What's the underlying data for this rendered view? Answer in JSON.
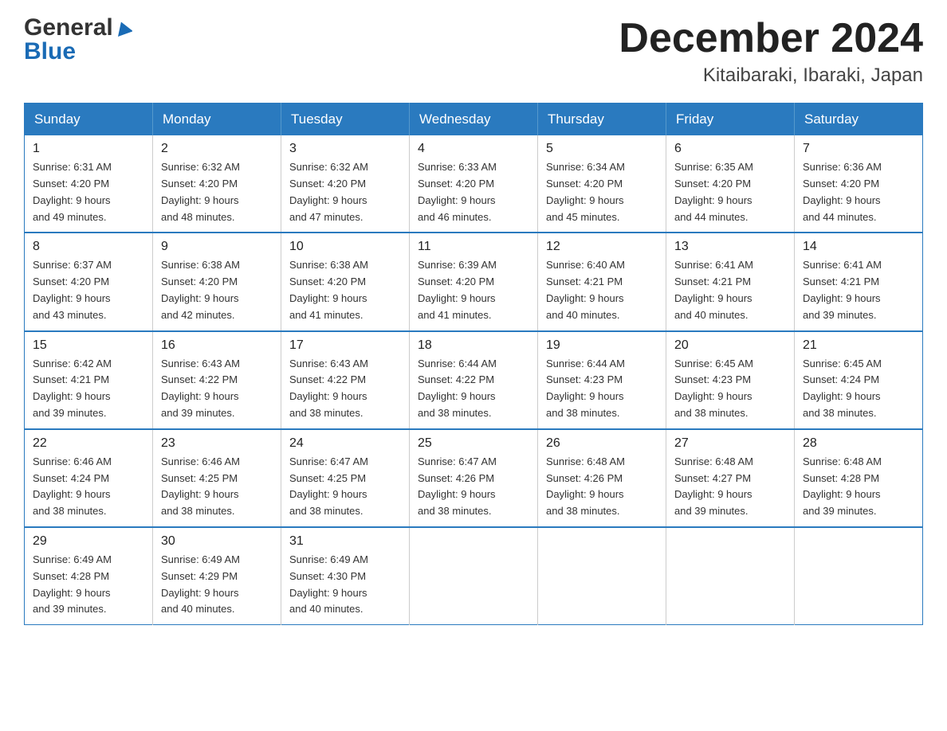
{
  "header": {
    "logo": {
      "general": "General",
      "blue": "Blue"
    },
    "title": "December 2024",
    "subtitle": "Kitaibaraki, Ibaraki, Japan"
  },
  "calendar": {
    "headers": [
      "Sunday",
      "Monday",
      "Tuesday",
      "Wednesday",
      "Thursday",
      "Friday",
      "Saturday"
    ],
    "weeks": [
      [
        {
          "day": "1",
          "sunrise": "6:31 AM",
          "sunset": "4:20 PM",
          "daylight": "9 hours and 49 minutes."
        },
        {
          "day": "2",
          "sunrise": "6:32 AM",
          "sunset": "4:20 PM",
          "daylight": "9 hours and 48 minutes."
        },
        {
          "day": "3",
          "sunrise": "6:32 AM",
          "sunset": "4:20 PM",
          "daylight": "9 hours and 47 minutes."
        },
        {
          "day": "4",
          "sunrise": "6:33 AM",
          "sunset": "4:20 PM",
          "daylight": "9 hours and 46 minutes."
        },
        {
          "day": "5",
          "sunrise": "6:34 AM",
          "sunset": "4:20 PM",
          "daylight": "9 hours and 45 minutes."
        },
        {
          "day": "6",
          "sunrise": "6:35 AM",
          "sunset": "4:20 PM",
          "daylight": "9 hours and 44 minutes."
        },
        {
          "day": "7",
          "sunrise": "6:36 AM",
          "sunset": "4:20 PM",
          "daylight": "9 hours and 44 minutes."
        }
      ],
      [
        {
          "day": "8",
          "sunrise": "6:37 AM",
          "sunset": "4:20 PM",
          "daylight": "9 hours and 43 minutes."
        },
        {
          "day": "9",
          "sunrise": "6:38 AM",
          "sunset": "4:20 PM",
          "daylight": "9 hours and 42 minutes."
        },
        {
          "day": "10",
          "sunrise": "6:38 AM",
          "sunset": "4:20 PM",
          "daylight": "9 hours and 41 minutes."
        },
        {
          "day": "11",
          "sunrise": "6:39 AM",
          "sunset": "4:20 PM",
          "daylight": "9 hours and 41 minutes."
        },
        {
          "day": "12",
          "sunrise": "6:40 AM",
          "sunset": "4:21 PM",
          "daylight": "9 hours and 40 minutes."
        },
        {
          "day": "13",
          "sunrise": "6:41 AM",
          "sunset": "4:21 PM",
          "daylight": "9 hours and 40 minutes."
        },
        {
          "day": "14",
          "sunrise": "6:41 AM",
          "sunset": "4:21 PM",
          "daylight": "9 hours and 39 minutes."
        }
      ],
      [
        {
          "day": "15",
          "sunrise": "6:42 AM",
          "sunset": "4:21 PM",
          "daylight": "9 hours and 39 minutes."
        },
        {
          "day": "16",
          "sunrise": "6:43 AM",
          "sunset": "4:22 PM",
          "daylight": "9 hours and 39 minutes."
        },
        {
          "day": "17",
          "sunrise": "6:43 AM",
          "sunset": "4:22 PM",
          "daylight": "9 hours and 38 minutes."
        },
        {
          "day": "18",
          "sunrise": "6:44 AM",
          "sunset": "4:22 PM",
          "daylight": "9 hours and 38 minutes."
        },
        {
          "day": "19",
          "sunrise": "6:44 AM",
          "sunset": "4:23 PM",
          "daylight": "9 hours and 38 minutes."
        },
        {
          "day": "20",
          "sunrise": "6:45 AM",
          "sunset": "4:23 PM",
          "daylight": "9 hours and 38 minutes."
        },
        {
          "day": "21",
          "sunrise": "6:45 AM",
          "sunset": "4:24 PM",
          "daylight": "9 hours and 38 minutes."
        }
      ],
      [
        {
          "day": "22",
          "sunrise": "6:46 AM",
          "sunset": "4:24 PM",
          "daylight": "9 hours and 38 minutes."
        },
        {
          "day": "23",
          "sunrise": "6:46 AM",
          "sunset": "4:25 PM",
          "daylight": "9 hours and 38 minutes."
        },
        {
          "day": "24",
          "sunrise": "6:47 AM",
          "sunset": "4:25 PM",
          "daylight": "9 hours and 38 minutes."
        },
        {
          "day": "25",
          "sunrise": "6:47 AM",
          "sunset": "4:26 PM",
          "daylight": "9 hours and 38 minutes."
        },
        {
          "day": "26",
          "sunrise": "6:48 AM",
          "sunset": "4:26 PM",
          "daylight": "9 hours and 38 minutes."
        },
        {
          "day": "27",
          "sunrise": "6:48 AM",
          "sunset": "4:27 PM",
          "daylight": "9 hours and 39 minutes."
        },
        {
          "day": "28",
          "sunrise": "6:48 AM",
          "sunset": "4:28 PM",
          "daylight": "9 hours and 39 minutes."
        }
      ],
      [
        {
          "day": "29",
          "sunrise": "6:49 AM",
          "sunset": "4:28 PM",
          "daylight": "9 hours and 39 minutes."
        },
        {
          "day": "30",
          "sunrise": "6:49 AM",
          "sunset": "4:29 PM",
          "daylight": "9 hours and 40 minutes."
        },
        {
          "day": "31",
          "sunrise": "6:49 AM",
          "sunset": "4:30 PM",
          "daylight": "9 hours and 40 minutes."
        },
        null,
        null,
        null,
        null
      ]
    ]
  }
}
